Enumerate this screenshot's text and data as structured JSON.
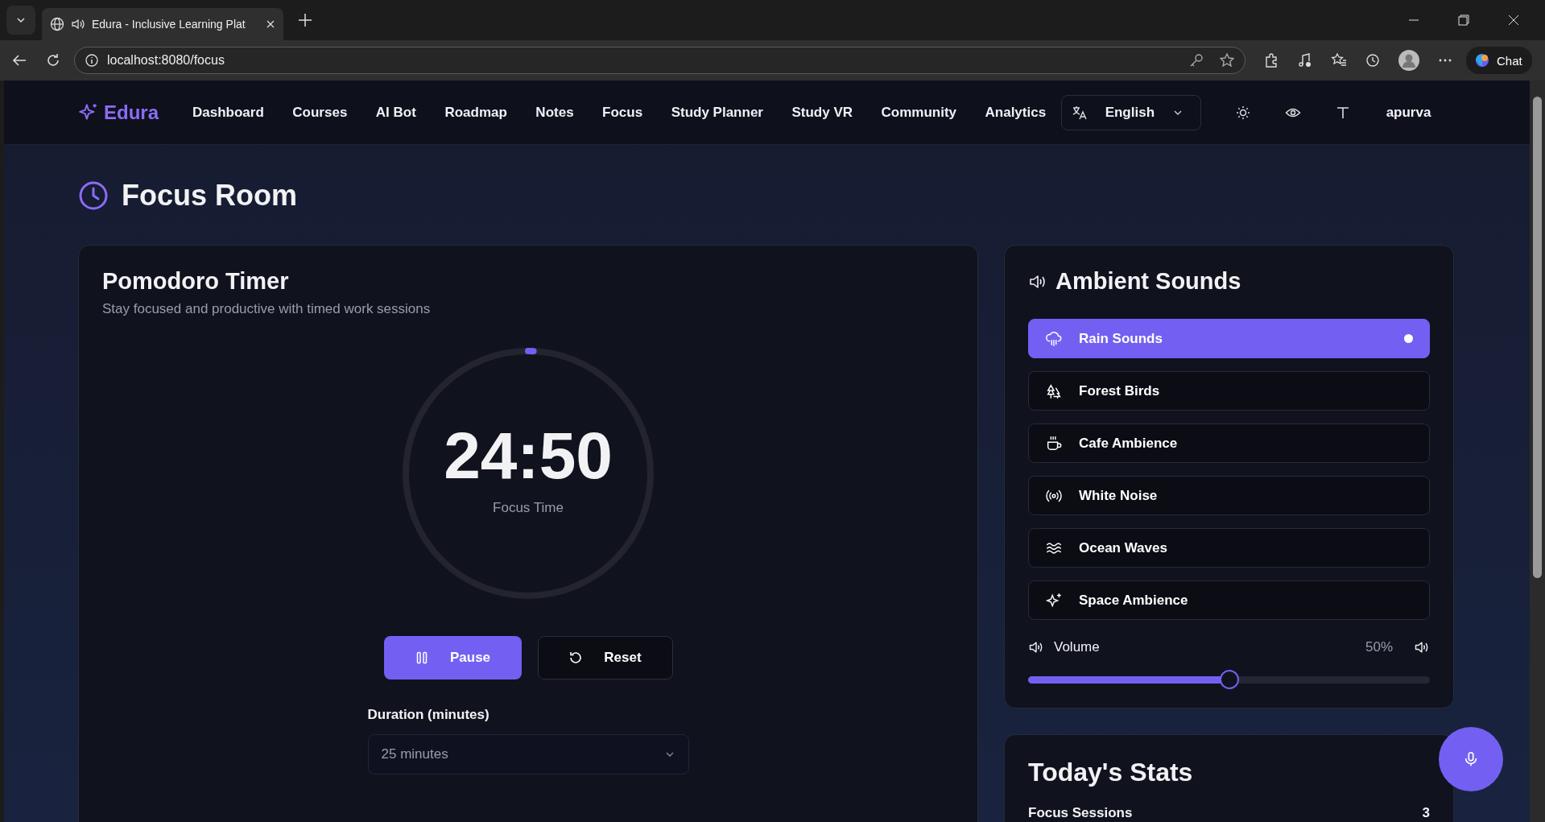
{
  "browser": {
    "tab_title": "Edura - Inclusive Learning Plat",
    "address": "localhost:8080/focus",
    "chat_label": "Chat"
  },
  "nav": {
    "brand": "Edura",
    "links": [
      {
        "label": "Dashboard"
      },
      {
        "label": "Courses"
      },
      {
        "label": "AI Bot"
      },
      {
        "label": "Roadmap"
      },
      {
        "label": "Notes"
      },
      {
        "label": "Focus"
      },
      {
        "label": "Study Planner"
      },
      {
        "label": "Study VR"
      },
      {
        "label": "Community"
      },
      {
        "label": "Analytics"
      }
    ],
    "language": "English",
    "user": "apurva"
  },
  "page_title": "Focus Room",
  "timer": {
    "title": "Pomodoro Timer",
    "subtitle": "Stay focused and productive with timed work sessions",
    "time": "24:50",
    "caption": "Focus Time",
    "level": 0.007,
    "buttons": [
      {
        "label": "Pause",
        "kind": "primary"
      },
      {
        "label": "Reset",
        "kind": "secondary"
      }
    ],
    "duration_label": "Duration (minutes)",
    "duration_value": "25 minutes"
  },
  "sounds": {
    "title": "Ambient Sounds",
    "items": [
      {
        "label": "Rain Sounds",
        "kind": "rain",
        "selected": true
      },
      {
        "label": "Forest Birds",
        "kind": "forest",
        "selected": false
      },
      {
        "label": "Cafe Ambience",
        "kind": "cafe",
        "selected": false
      },
      {
        "label": "White Noise",
        "kind": "noise",
        "selected": false
      },
      {
        "label": "Ocean Waves",
        "kind": "waves",
        "selected": false
      },
      {
        "label": "Space Ambience",
        "kind": "space",
        "selected": false
      }
    ],
    "volume": {
      "label": "Volume",
      "reading": "50%",
      "level": 0.5
    }
  },
  "stats": {
    "title": "Today's Stats",
    "rows": [
      {
        "label": "Focus Sessions",
        "value": "3"
      }
    ]
  }
}
